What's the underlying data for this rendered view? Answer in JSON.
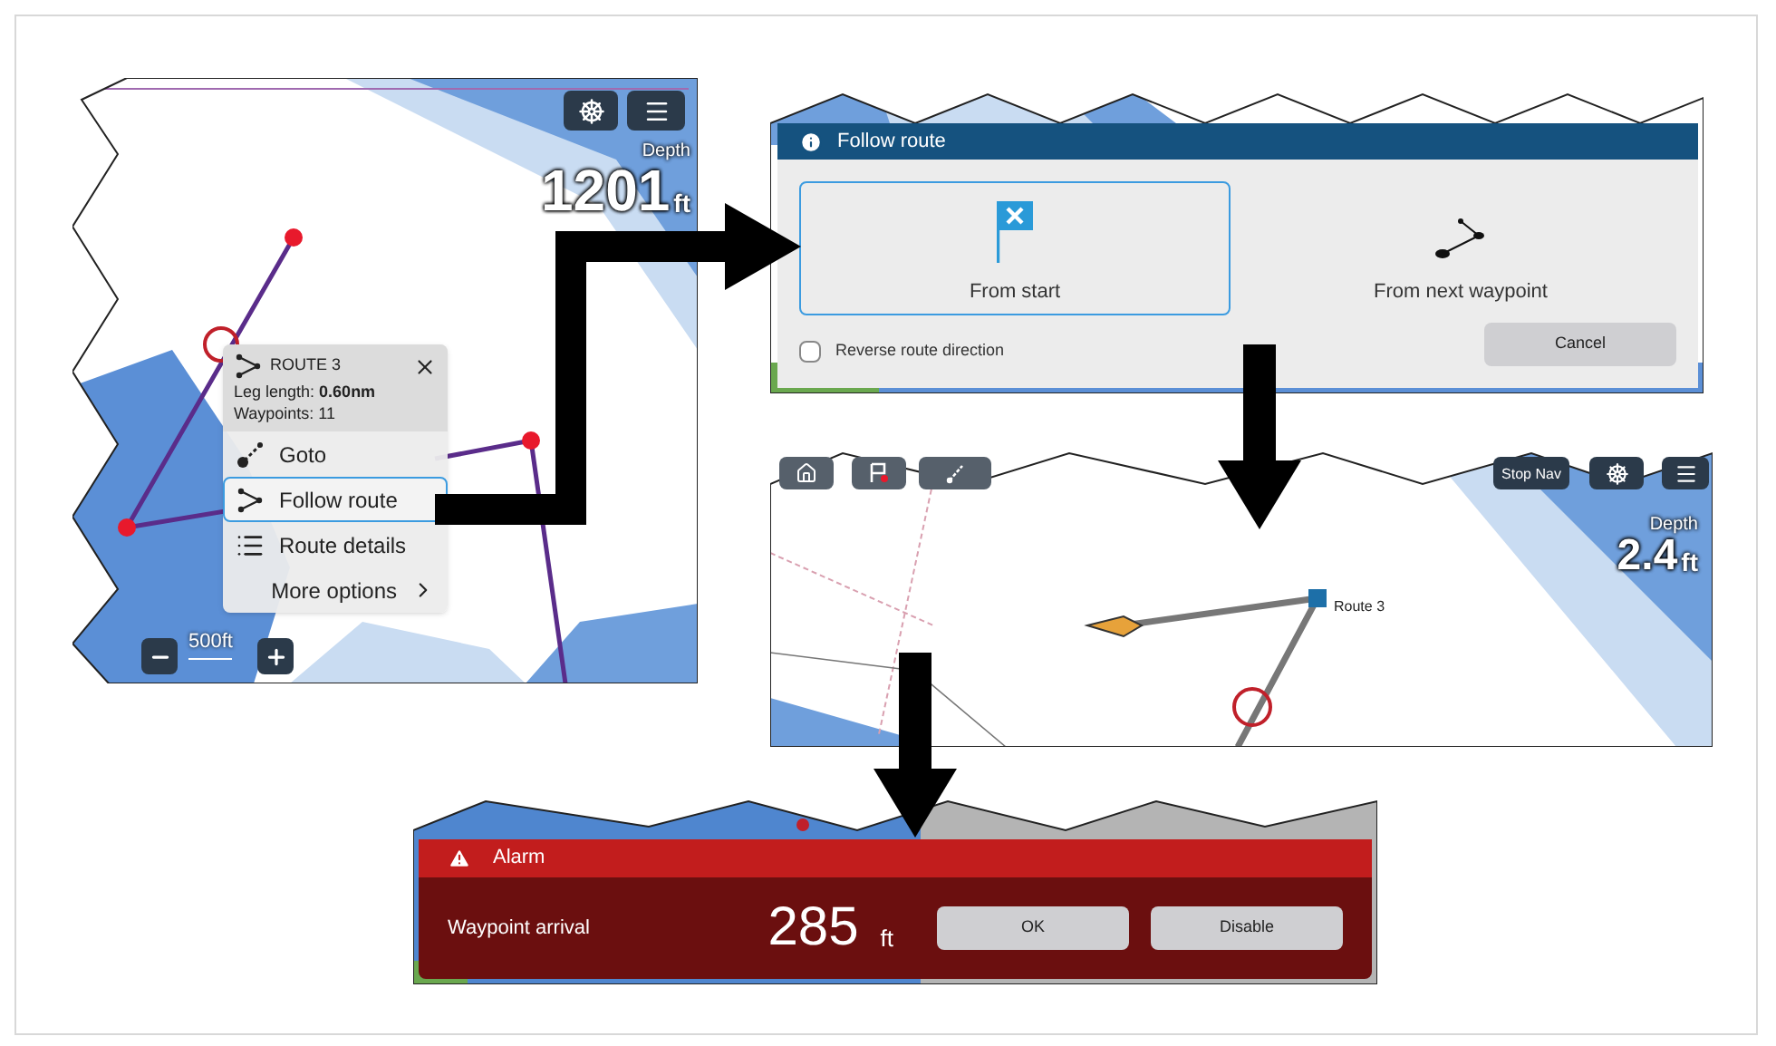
{
  "chart_screen": {
    "depth_label": "Depth",
    "depth_value": "1201",
    "depth_unit": "ft",
    "scale": "500ft",
    "context_menu": {
      "title": "ROUTE 3",
      "details": [
        "Leg length: **0.60nm**",
        "Waypoints: 11"
      ],
      "items": [
        {
          "kind": "goto",
          "label": "Goto",
          "selected": false
        },
        {
          "kind": "route",
          "label": "Follow route",
          "selected": true
        },
        {
          "kind": "list",
          "label": "Route details",
          "selected": false
        },
        {
          "kind": "more",
          "label": "More options",
          "selected": false
        }
      ]
    }
  },
  "follow_route_dialog": {
    "title": "Follow route",
    "options": [
      {
        "kind": "start",
        "label": "From start",
        "selected": true
      },
      {
        "kind": "next",
        "label": "From next waypoint",
        "selected": false
      }
    ],
    "checkbox": {
      "label": "Reverse route direction",
      "checked": false
    },
    "cancel": "Cancel"
  },
  "navigation_screen": {
    "stop_button": "Stop Nav",
    "depth_label": "Depth",
    "depth_value": "2.4",
    "depth_unit": "ft",
    "route_label": "Route 3"
  },
  "alarm": {
    "title": "Alarm",
    "message": "Waypoint arrival",
    "value": "285",
    "unit": "ft",
    "buttons": [
      "OK",
      "Disable"
    ]
  }
}
